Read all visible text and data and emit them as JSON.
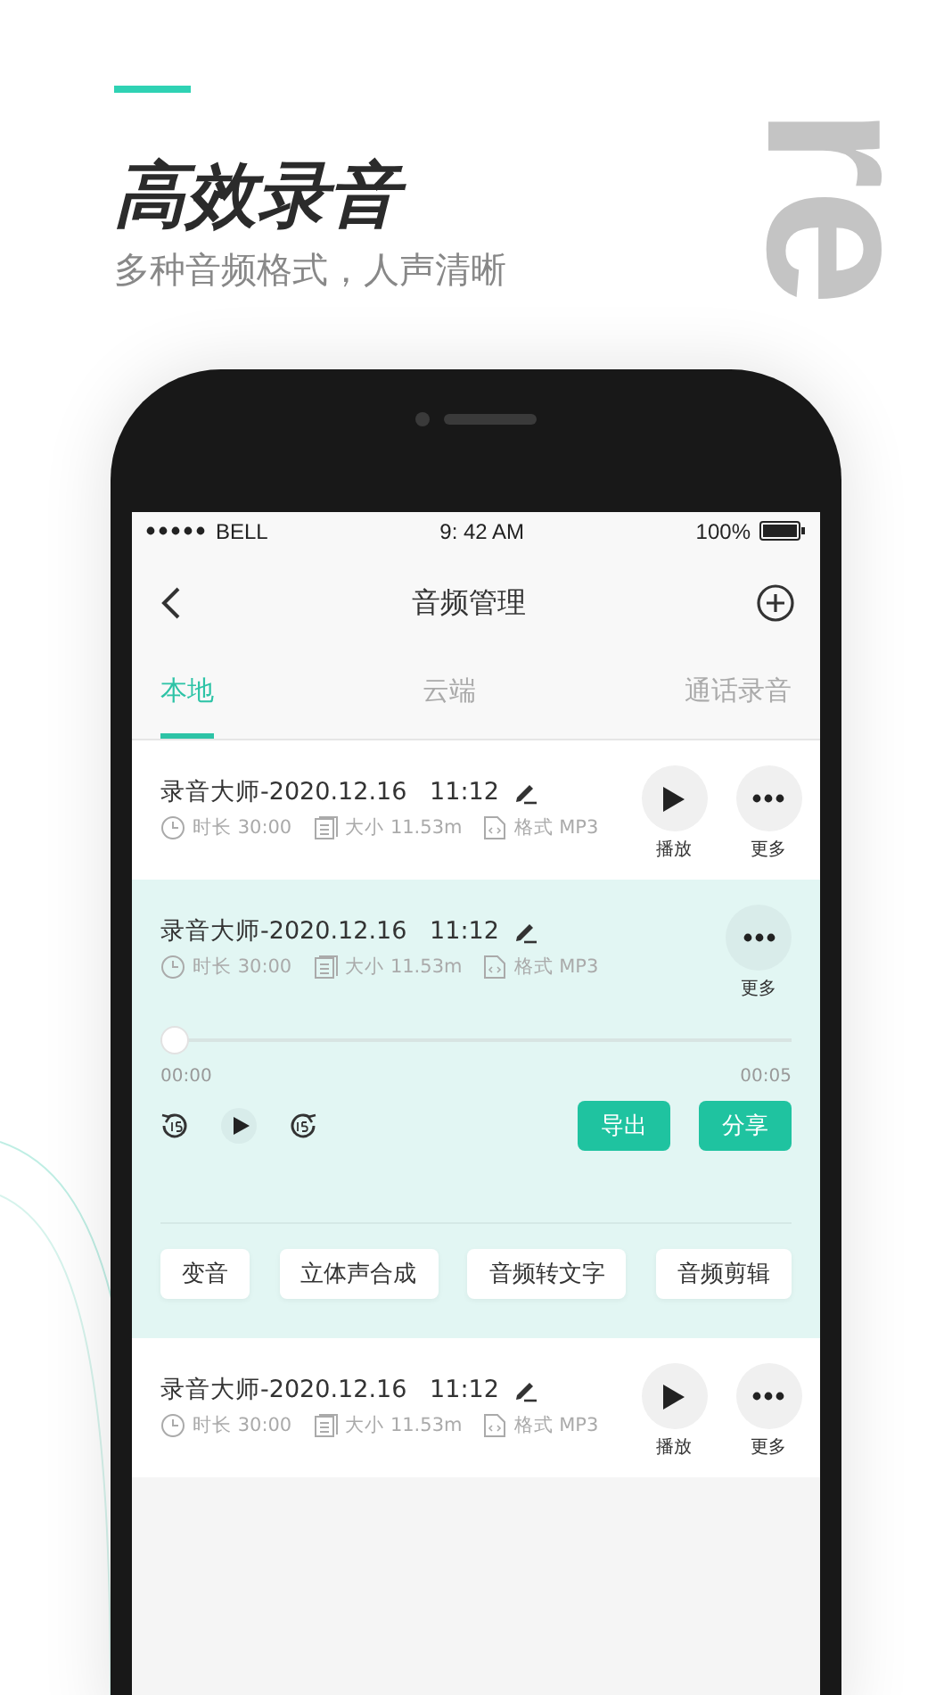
{
  "hero": {
    "title": "高效录音",
    "subtitle": "多种音频格式，人声清晰",
    "backdrop_text": "re"
  },
  "status_bar": {
    "carrier": "BELL",
    "time": "9: 42 AM",
    "battery": "100%"
  },
  "nav": {
    "title": "音频管理"
  },
  "tabs": [
    {
      "label": "本地",
      "selected": true
    },
    {
      "label": "云端",
      "selected": false
    },
    {
      "label": "通话录音",
      "selected": false
    }
  ],
  "recordings": [
    {
      "name": "录音大师-2020.12.16   11:12",
      "duration": "时长 30:00",
      "size": "大小 11.53m",
      "format": "格式 MP3",
      "expanded": false,
      "actions": [
        {
          "kind": "play",
          "label": "播放"
        },
        {
          "kind": "more",
          "label": "更多"
        }
      ]
    },
    {
      "name": "录音大师-2020.12.16   11:12",
      "duration": "时长 30:00",
      "size": "大小 11.53m",
      "format": "格式 MP3",
      "expanded": true,
      "actions": [
        {
          "kind": "more",
          "label": "更多"
        }
      ],
      "player": {
        "level": 0,
        "start": "00:00",
        "end": "00:05",
        "buttons": [
          "导出",
          "分享"
        ],
        "tools": [
          "变音",
          "立体声合成",
          "音频转文字",
          "音频剪辑"
        ]
      }
    },
    {
      "name": "录音大师-2020.12.16   11:12",
      "duration": "时长 30:00",
      "size": "大小 11.53m",
      "format": "格式 MP3",
      "expanded": false,
      "actions": [
        {
          "kind": "play",
          "label": "播放"
        },
        {
          "kind": "more",
          "label": "更多"
        }
      ]
    }
  ]
}
